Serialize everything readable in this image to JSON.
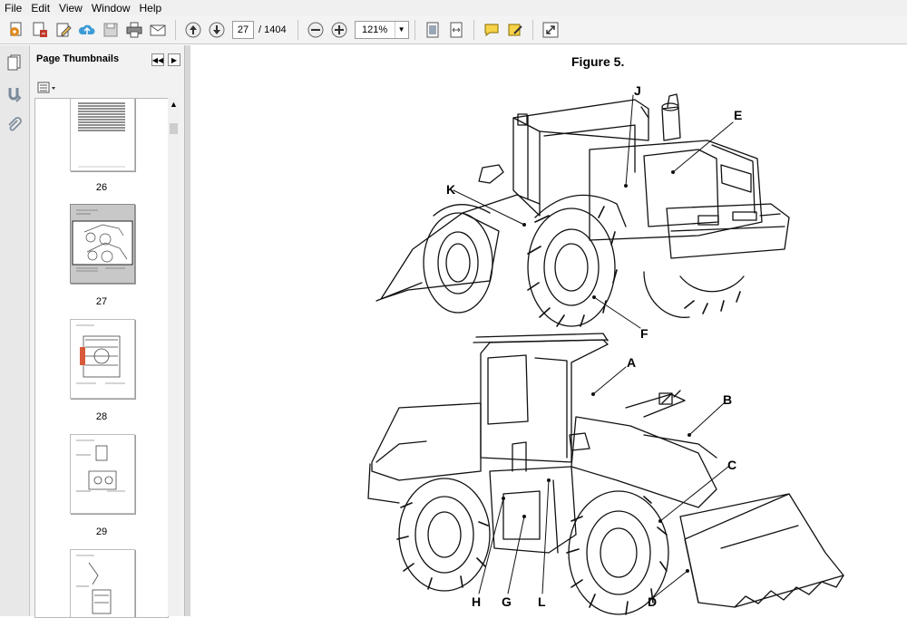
{
  "menu": {
    "items": [
      "File",
      "Edit",
      "View",
      "Window",
      "Help"
    ]
  },
  "toolbar": {
    "current_page": "27",
    "page_total": "/ 1404",
    "zoom": "121%",
    "icons": [
      "create-pdf-icon",
      "export-icon",
      "edit-icon",
      "upload-icon",
      "save-icon",
      "print-icon",
      "email-icon",
      "previous-page-icon",
      "next-page-icon",
      "zoom-out-icon",
      "zoom-in-icon",
      "fit-page-icon",
      "fit-width-icon",
      "comment-icon",
      "sign-icon",
      "expand-icon"
    ]
  },
  "rail": {
    "icons": [
      "pages-icon",
      "bookmarks-icon",
      "attachments-icon"
    ]
  },
  "panel": {
    "title": "Page Thumbnails",
    "thumbnails": [
      {
        "label": "26",
        "selected": false
      },
      {
        "label": "27",
        "selected": true
      },
      {
        "label": "28",
        "selected": false
      },
      {
        "label": "29",
        "selected": false
      },
      {
        "label": "",
        "selected": false
      }
    ]
  },
  "document": {
    "figure_title": "Figure 5.",
    "callouts": [
      "J",
      "E",
      "K",
      "F",
      "A",
      "B",
      "C",
      "H",
      "G",
      "L",
      "D"
    ]
  }
}
